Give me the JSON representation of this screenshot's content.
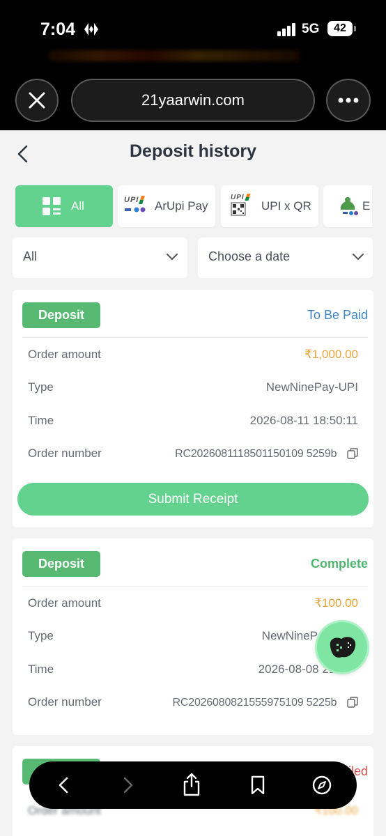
{
  "status_bar": {
    "time": "7:04",
    "network": "5G",
    "battery": "42"
  },
  "browser": {
    "url": "21yaarwin.com"
  },
  "header": {
    "title": "Deposit history"
  },
  "tabs": [
    {
      "label": "All",
      "active": true
    },
    {
      "label": "ArUpi Pay",
      "logo": "UPI"
    },
    {
      "label": "UPI x QR",
      "logo": "UPI"
    },
    {
      "label": "E"
    }
  ],
  "filters": {
    "status": "All",
    "date": "Choose a date"
  },
  "labels": {
    "order_amount": "Order amount",
    "type": "Type",
    "time": "Time",
    "order_number": "Order number",
    "submit": "Submit Receipt"
  },
  "records": [
    {
      "badge": "Deposit",
      "status": "To Be Paid",
      "status_color": "#3f86c6",
      "amount": "₹1,000.00",
      "type": "NewNinePay-UPI",
      "time": "2026-08-11 18:50:11",
      "order_number": "RC2026081118501150109 5259b"
    },
    {
      "badge": "Deposit",
      "status": "Complete",
      "status_color": "#4fb56e",
      "amount": "₹100.00",
      "type": "NewNineP",
      "time": "2026-08-08 21:",
      "order_number": "RC2026080821555975109 5225b"
    },
    {
      "badge": "Deposit",
      "status": "iled",
      "status_color": "#d9534f",
      "amount": "₹100.00",
      "order_amount_label": "Order amount"
    }
  ],
  "colors": {
    "accent": "#62d28e",
    "badge": "#57b972",
    "amount": "#e8a23a"
  }
}
